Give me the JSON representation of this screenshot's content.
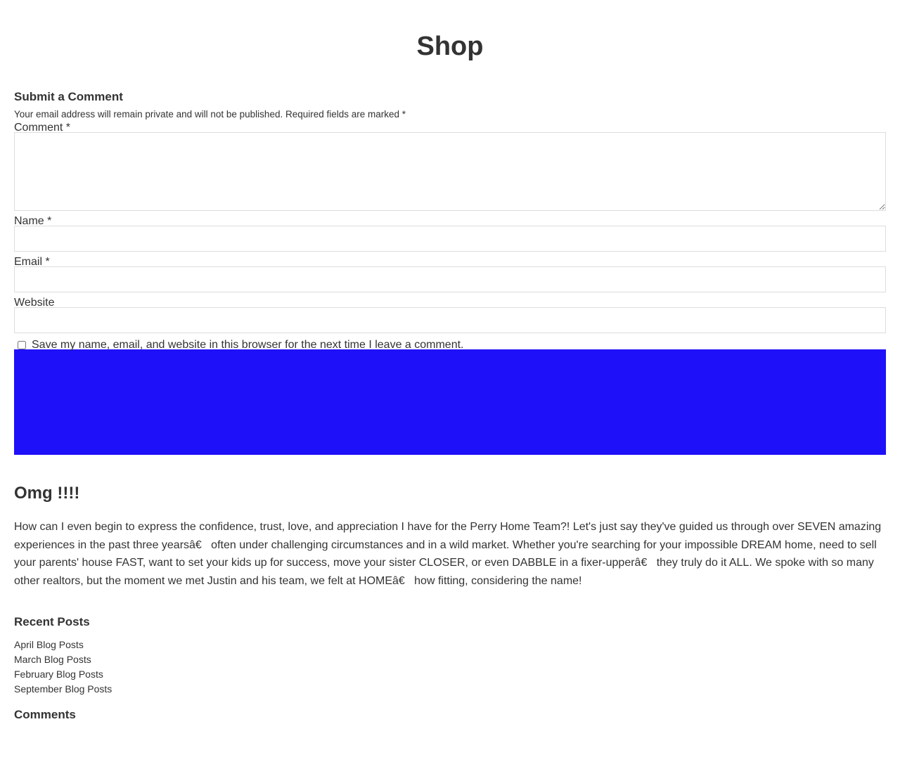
{
  "page_title": "Shop",
  "comment_form": {
    "heading": "Submit a Comment",
    "note": "Your email address will remain private and will not be published. Required fields are marked *",
    "comment_label": "Comment *",
    "comment_value": "",
    "name_label": "Name *",
    "name_value": "",
    "email_label": "Email *",
    "email_value": "",
    "website_label": "Website",
    "website_value": "",
    "save_label": "Save my name, email, and website in this browser for the next time I leave a comment.",
    "submit_color": "#1e10f8"
  },
  "post": {
    "title": "Omg !!!!",
    "body": "How can I even begin to express the confidence, trust, love, and appreciation I have for the Perry Home Team?! Let's just say they've guided us through over SEVEN amazing experiences in the past three yearsâ€   often under challenging circumstances and in a wild market. Whether you're searching for your impossible DREAM home, need to sell your parents' house FAST, want to set your kids up for success, move your sister CLOSER, or even DABBLE in a fixer-upperâ€   they truly do it ALL. We spoke with so many other realtors, but the moment we met Justin and his team, we felt at HOMEâ€   how fitting, considering the name!"
  },
  "sidebar": {
    "recent_heading": "Recent Posts",
    "recent_posts": [
      "April Blog Posts",
      "March Blog Posts",
      "February Blog Posts",
      "September Blog Posts"
    ],
    "comments_heading": "Comments"
  }
}
